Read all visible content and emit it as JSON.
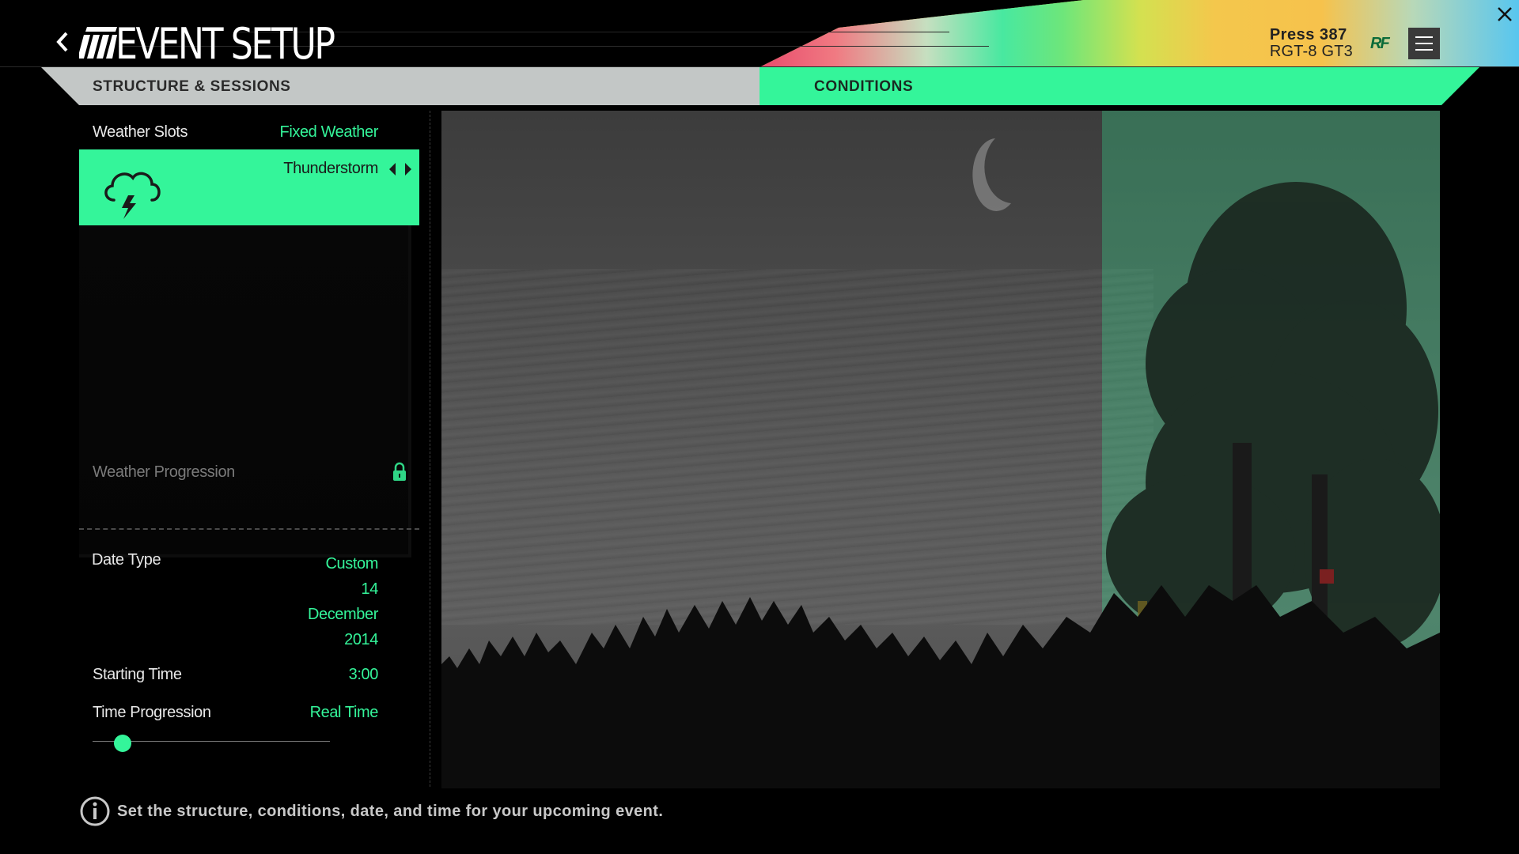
{
  "header": {
    "title": "EVENT SETUP",
    "car_name": "Press 387",
    "car_model": "RGT-8 GT3",
    "brand_logo": "RF"
  },
  "tabs": [
    {
      "label": "STRUCTURE & SESSIONS",
      "active": false
    },
    {
      "label": "CONDITIONS",
      "active": true
    }
  ],
  "conditions": {
    "weather_slots_label": "Weather Slots",
    "weather_slots_value": "Fixed Weather",
    "weather_slot": {
      "name": "Thunderstorm",
      "icon": "thunderstorm-cloud-icon"
    },
    "weather_progression_label": "Weather Progression",
    "weather_progression_locked": true,
    "date_type_label": "Date Type",
    "date_type_value": "Custom",
    "date_day": "14",
    "date_month": "December",
    "date_year": "2014",
    "starting_time_label": "Starting Time",
    "starting_time_value": "3:00",
    "time_progression_label": "Time Progression",
    "time_progression_value": "Real Time",
    "time_progression_slider": 0.1
  },
  "footer": {
    "hint": "Set the structure, conditions, date, and time for your upcoming event."
  },
  "colors": {
    "accent": "#34f59a",
    "tab_inactive": "#c3c7c6",
    "background": "#000000"
  }
}
